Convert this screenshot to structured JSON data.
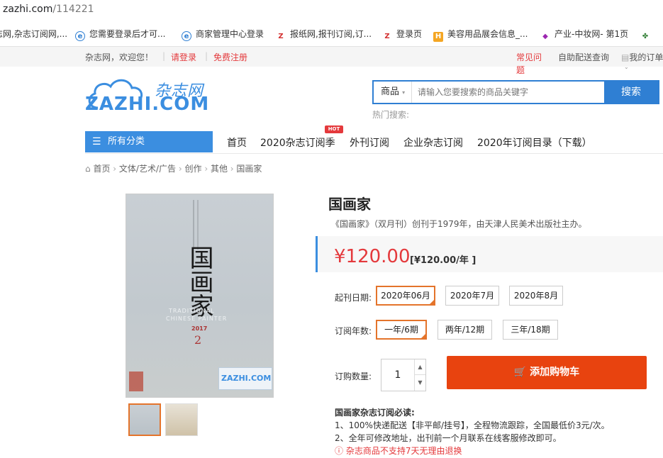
{
  "browser": {
    "url_host": "zazhi.com",
    "url_path": "/114221",
    "bookmarks": [
      {
        "label": "志网,杂志订阅网,..."
      },
      {
        "label": "您需要登录后才可..."
      },
      {
        "label": "商家管理中心登录"
      },
      {
        "label": "报纸网,报刊订阅,订..."
      },
      {
        "label": "登录页"
      },
      {
        "label": "美容用品展会信息_..."
      },
      {
        "label": "产业-中妆网- 第1页"
      }
    ]
  },
  "topbar": {
    "welcome": "杂志网，欢迎您！",
    "login": "请登录",
    "register": "免费注册",
    "faq": "常见问题",
    "auto_delivery": "自助配送查询",
    "my_orders": "我的订单"
  },
  "header": {
    "logo_cn": "杂志网",
    "logo_en": "ZAZHI.COM",
    "search_category": "商品",
    "search_placeholder": "请输入您要搜索的商品关键字",
    "search_button": "搜索",
    "hot_search_label": "热门搜索:"
  },
  "nav": {
    "all_categories": "所有分类",
    "items": [
      "首页",
      "2020杂志订阅季",
      "外刊订阅",
      "企业杂志订阅",
      "2020年订阅目录（下载）"
    ],
    "hot_badge": "HOT"
  },
  "breadcrumb": [
    "首页",
    "文体/艺术/广告",
    "创作",
    "其他",
    "国画家"
  ],
  "product": {
    "cover_title_cn": "国画家",
    "cover_title_en_1": "TRADITIONAL",
    "cover_title_en_2": "CHINESE PAINTER",
    "cover_issue": "2",
    "cover_year": "2017",
    "title": "国画家",
    "description": "《国画家》（双月刊）创刊于1979年，由天津人民美术出版社主办。",
    "price": "¥120.00",
    "price_per_year": "[¥120.00/年 ]",
    "start_date_label": "起刊日期:",
    "start_dates": [
      "2020年06月",
      "2020年7月",
      "2020年8月"
    ],
    "start_date_selected": 0,
    "years_label": "订阅年数:",
    "years": [
      "一年/6期",
      "两年/12期",
      "三年/18期"
    ],
    "years_selected": 0,
    "qty_label": "订购数量:",
    "qty": "1",
    "add_to_cart": "添加购物车",
    "notes_title": "国画家杂志订阅必读:",
    "note_1": "1、100%快递配送【非平邮/挂号】，全程物流跟踪，全国最低价3元/次。",
    "note_2": "2、全年可修改地址，出刊前一个月联系在线客服修改即可。",
    "warning": "杂志商品不支持7天无理由退换"
  },
  "colors": {
    "brand_blue": "#2f7fd3",
    "accent_red": "#e4393c",
    "cart_orange": "#e8430f",
    "select_border": "#e4742b"
  }
}
